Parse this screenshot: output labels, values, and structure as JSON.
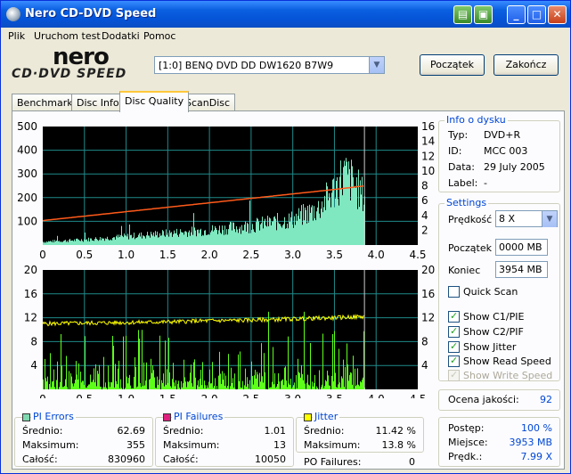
{
  "window": {
    "title": "Nero CD-DVD Speed"
  },
  "menu": [
    "Plik",
    "Uruchom test",
    "Dodatki",
    "Pomoc"
  ],
  "logo": {
    "top": "nero",
    "bottom": "CD·DVD SPEED"
  },
  "drive": {
    "selected": "[1:0]   BENQ DVD DD DW1620 B7W9"
  },
  "buttons": {
    "start": "Początek",
    "exit": "Zakończ"
  },
  "tabs": [
    "Benchmark",
    "Disc Info",
    "Disc Quality",
    "ScanDisc"
  ],
  "disc_info": {
    "title": "Info o dysku",
    "type_label": "Typ:",
    "type_value": "DVD+R",
    "id_label": "ID:",
    "id_value": "MCC 003",
    "date_label": "Data:",
    "date_value": "29 July 2005",
    "label_label": "Label:",
    "label_value": "-"
  },
  "settings": {
    "title": "Settings",
    "speed_label": "Prędkość",
    "speed_value": "8 X",
    "start_label": "Początek",
    "start_value": "0000 MB",
    "end_label": "Koniec",
    "end_value": "3954 MB",
    "quick_scan": "Quick Scan",
    "show_c1": "Show C1/PIE",
    "show_c2": "Show C2/PIF",
    "show_jitter": "Show Jitter",
    "show_read": "Show Read Speed",
    "show_write": "Show Write Speed"
  },
  "quality": {
    "label": "Ocena jakości:",
    "value": "92"
  },
  "progress": {
    "postep_label": "Postęp:",
    "postep_value": "100 %",
    "miejsce_label": "Miejsce:",
    "miejsce_value": "3953 MB",
    "predk_label": "Prędk.:",
    "predk_value": "7.99 X"
  },
  "pi_errors": {
    "title": "PI Errors",
    "avg_label": "Średnio:",
    "avg": "62.69",
    "max_label": "Maksimum:",
    "max": "355",
    "total_label": "Całość:",
    "total": "830960",
    "color": "#7fd8b0"
  },
  "pi_failures": {
    "title": "PI Failures",
    "avg_label": "Średnio:",
    "avg": "1.01",
    "max_label": "Maksimum:",
    "max": "13",
    "total_label": "Całość:",
    "total": "10050",
    "color": "#e0207f"
  },
  "jitter": {
    "title": "Jitter",
    "avg_label": "Średnio:",
    "avg": "11.42 %",
    "max_label": "Maksimum:",
    "max": "13.8 %",
    "po_label": "PO Failures:",
    "po": "0",
    "color": "#ffff00"
  },
  "chart_data": [
    {
      "type": "area",
      "name": "PI Errors / Read Speed",
      "x_ticks": [
        "0",
        "0.5",
        "1.0",
        "1.5",
        "2.0",
        "2.5",
        "3.0",
        "3.5",
        "4.0",
        "4.5"
      ],
      "y_left_ticks": [
        "500",
        "400",
        "300",
        "200",
        "100"
      ],
      "y_right_ticks": [
        "16",
        "14",
        "12",
        "10",
        "8",
        "6",
        "4",
        "2"
      ],
      "xlim": [
        0,
        4.5
      ],
      "ylim_left": [
        0,
        500
      ],
      "ylim_right": [
        0,
        16
      ],
      "pie_series": {
        "x": [
          0,
          0.5,
          1.0,
          1.5,
          2.0,
          2.5,
          3.0,
          3.3,
          3.5,
          3.6,
          3.7,
          3.8,
          3.86
        ],
        "values": [
          15,
          25,
          40,
          55,
          70,
          90,
          120,
          170,
          260,
          330,
          300,
          250,
          220
        ]
      },
      "read_speed": {
        "x": [
          0,
          0.5,
          1.0,
          1.5,
          2.0,
          2.5,
          3.0,
          3.5,
          3.86
        ],
        "values": [
          3.3,
          3.9,
          4.5,
          5.1,
          5.7,
          6.3,
          6.9,
          7.5,
          7.99
        ]
      },
      "end_marker_x": 3.86,
      "grid": true
    },
    {
      "type": "bar",
      "name": "PI Failures / Jitter",
      "x_ticks": [
        "0",
        "0.5",
        "1.0",
        "1.5",
        "2.0",
        "2.5",
        "3.0",
        "3.5",
        "4.0",
        "4.5"
      ],
      "y_left_ticks": [
        "20",
        "16",
        "12",
        "8",
        "4"
      ],
      "y_right_ticks": [
        "20",
        "16",
        "12",
        "8",
        "4"
      ],
      "xlim": [
        0,
        4.5
      ],
      "ylim": [
        0,
        20
      ],
      "pif_max": 13,
      "jitter": {
        "x": [
          0,
          0.5,
          1.0,
          1.5,
          2.0,
          2.5,
          3.0,
          3.5,
          3.86
        ],
        "values": [
          11.0,
          11.1,
          11.2,
          11.3,
          11.5,
          11.6,
          11.8,
          12.0,
          12.2
        ]
      },
      "end_marker_x": 3.86,
      "grid": true
    }
  ]
}
